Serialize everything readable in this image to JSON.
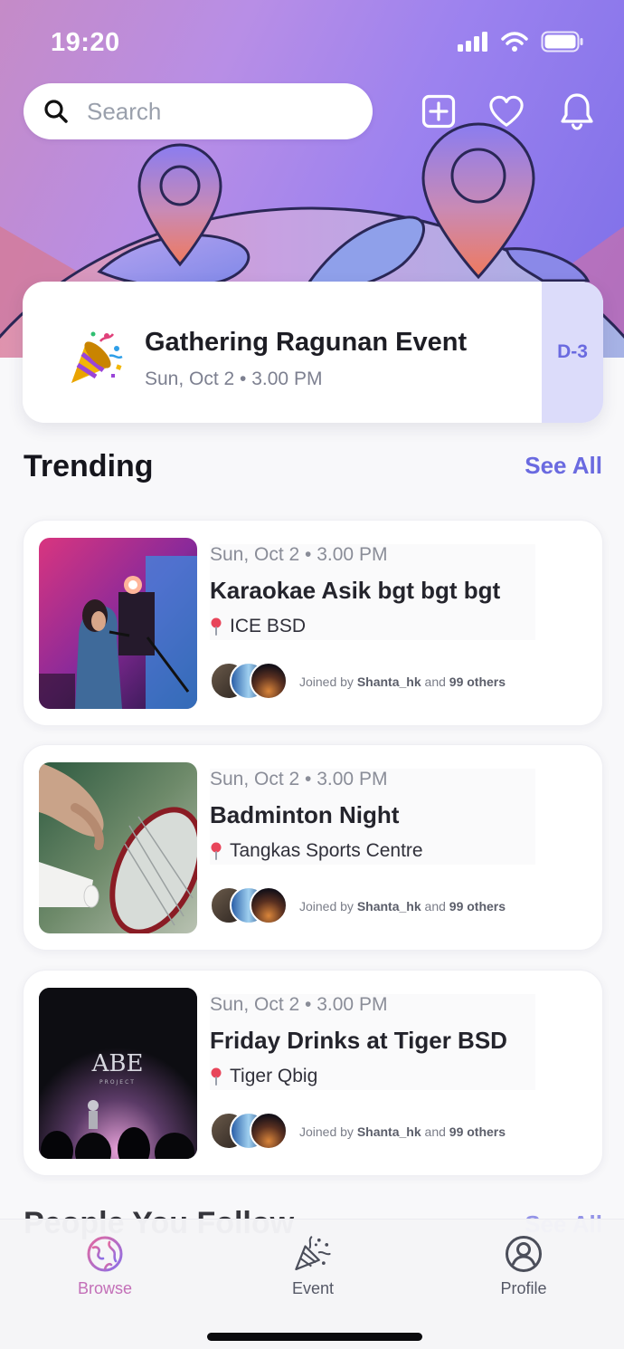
{
  "status_bar": {
    "time": "19:20"
  },
  "search": {
    "placeholder": "Search"
  },
  "header_icons": [
    "add-square-icon",
    "heart-icon",
    "bell-icon"
  ],
  "upcoming": {
    "title": "Gathering Ragunan Event",
    "time": "Sun, Oct 2 • 3.00 PM",
    "countdown": "D-3",
    "icon": "party-popper-icon"
  },
  "trending": {
    "title": "Trending",
    "see_all": "See All",
    "events": [
      {
        "time": "Sun, Oct 2 • 3.00 PM",
        "title": "Karaokae Asik bgt bgt bgt",
        "location": "ICE BSD",
        "joined_prefix": "Joined by ",
        "joined_user": "Shanta_hk",
        "joined_mid": " and ",
        "joined_count": "99 others"
      },
      {
        "time": "Sun, Oct 2 • 3.00 PM",
        "title": "Badminton Night",
        "location": "Tangkas Sports Centre",
        "joined_prefix": "Joined by ",
        "joined_user": "Shanta_hk",
        "joined_mid": " and ",
        "joined_count": "99 others"
      },
      {
        "time": "Sun, Oct 2 • 3.00 PM",
        "title": "Friday Drinks at Tiger BSD",
        "location": "Tiger Qbig",
        "joined_prefix": "Joined by ",
        "joined_user": "Shanta_hk",
        "joined_mid": " and ",
        "joined_count": "99 others"
      }
    ]
  },
  "people": {
    "title": "People You Follow",
    "see_all": "See All"
  },
  "tabbar": {
    "tabs": [
      {
        "label": "Browse",
        "icon": "globe-icon",
        "active": true
      },
      {
        "label": "Event",
        "icon": "party-popper-icon",
        "active": false
      },
      {
        "label": "Profile",
        "icon": "user-circle-icon",
        "active": false
      }
    ]
  },
  "colors": {
    "accent": "#6a6ae0",
    "active_tab": "#c36fb8",
    "hero_start": "#c58bc7",
    "hero_end": "#7d6fe8"
  }
}
